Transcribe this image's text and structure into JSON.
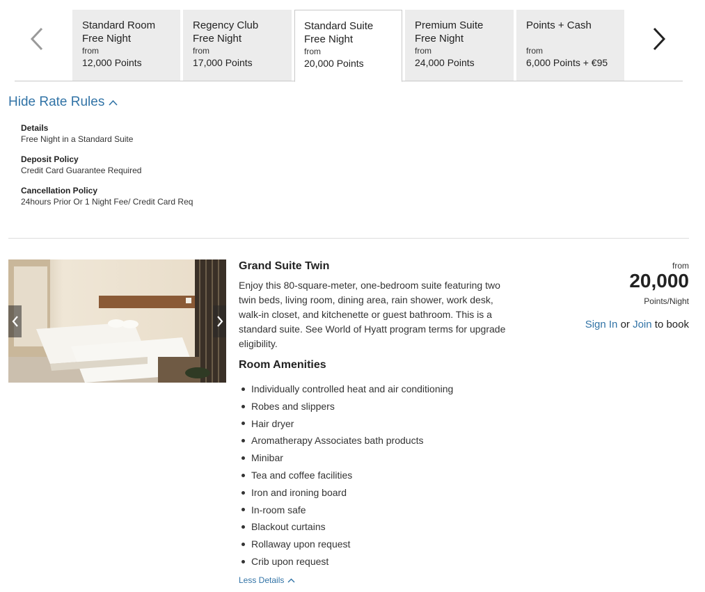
{
  "tabs": [
    {
      "name": "Standard Room Free Night",
      "from": "from",
      "points": "12,000 Points",
      "active": false
    },
    {
      "name": "Regency Club Free Night",
      "from": "from",
      "points": "17,000 Points",
      "active": false
    },
    {
      "name": "Standard Suite Free Night",
      "from": "from",
      "points": "20,000 Points",
      "active": true
    },
    {
      "name": "Premium Suite Free Night",
      "from": "from",
      "points": "24,000 Points",
      "active": false
    },
    {
      "name": "Points + Cash",
      "from": "from",
      "points": "6,000 Points + €95",
      "active": false
    }
  ],
  "rate_rules": {
    "toggle_label": "Hide Rate Rules",
    "details_label": "Details",
    "details_value": "Free Night in a Standard Suite",
    "deposit_label": "Deposit Policy",
    "deposit_value": "Credit Card Guarantee Required",
    "cancel_label": "Cancellation Policy",
    "cancel_value": "24hours Prior Or 1 Night Fee/ Credit Card Req"
  },
  "room": {
    "title": "Grand Suite Twin",
    "description": "Enjoy this 80-square-meter, one-bedroom suite featuring two twin beds, living room, dining area, rain shower, work desk, walk-in closet, and kitchenette or guest bathroom. This is a standard suite. See World of Hyatt program terms for upgrade eligibility.",
    "amenities_title": "Room Amenities",
    "amenities": [
      "Individually controlled heat and air conditioning",
      "Robes and slippers",
      "Hair dryer",
      "Aromatherapy Associates bath products",
      "Minibar",
      "Tea and coffee facilities",
      "Iron and ironing board",
      "In-room safe",
      "Blackout curtains",
      "Rollaway upon request",
      "Crib upon request"
    ],
    "less_details": "Less Details"
  },
  "price": {
    "from": "from",
    "value": "20,000",
    "unit": "Points/Night",
    "sign_in": "Sign In",
    "or": "or",
    "join": "Join",
    "to_book": "to book"
  },
  "colors": {
    "link": "#3173a6",
    "tab_bg": "#ececec"
  }
}
